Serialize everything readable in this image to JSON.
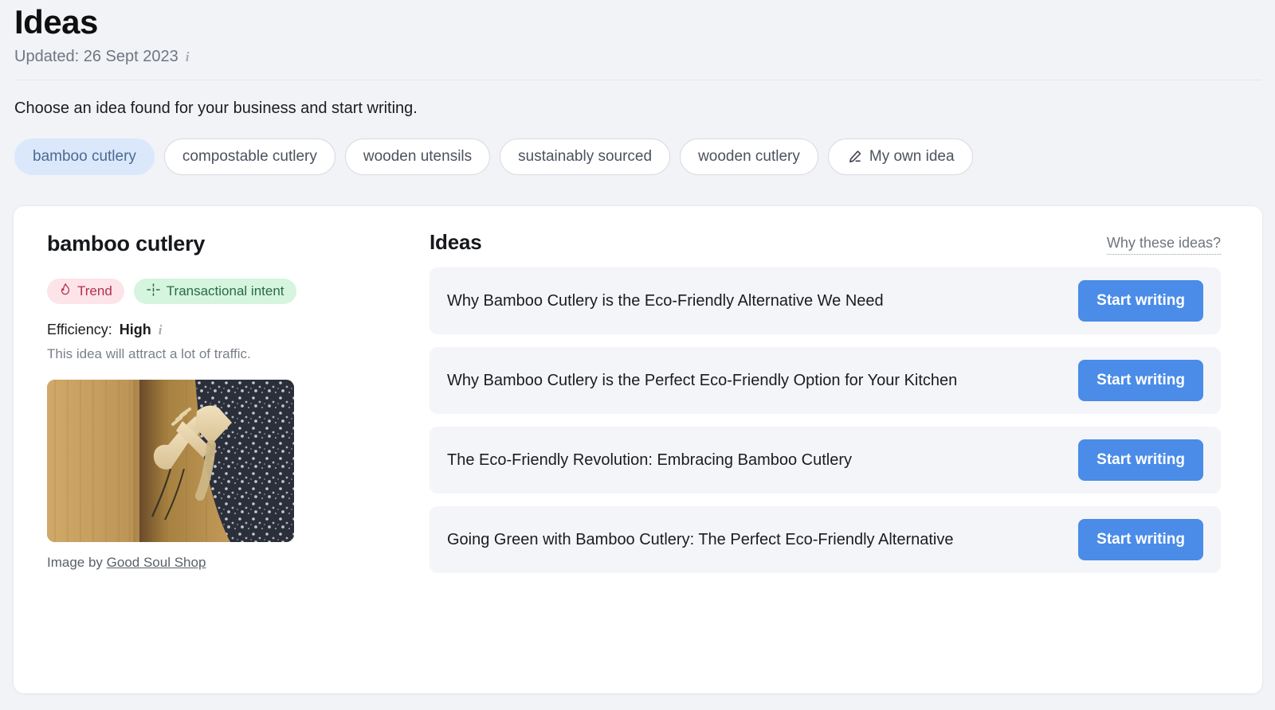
{
  "header": {
    "title": "Ideas",
    "updated_label": "Updated: 26 Sept 2023",
    "info_icon": "info-icon",
    "subtitle": "Choose an idea found for your business and start writing."
  },
  "chips": [
    {
      "label": "bamboo cutlery",
      "active": true,
      "icon": null
    },
    {
      "label": "compostable cutlery",
      "active": false,
      "icon": null
    },
    {
      "label": "wooden utensils",
      "active": false,
      "icon": null
    },
    {
      "label": "sustainably sourced",
      "active": false,
      "icon": null
    },
    {
      "label": "wooden cutlery",
      "active": false,
      "icon": null
    },
    {
      "label": "My own idea",
      "active": false,
      "icon": "pencil-icon"
    }
  ],
  "detail": {
    "keyword": "bamboo cutlery",
    "badges": [
      {
        "label": "Trend",
        "icon": "flame-icon",
        "bg": "#fce4e9",
        "fg": "#b2304b"
      },
      {
        "label": "Transactional intent",
        "icon": "intent-icon",
        "bg": "#d5f5de",
        "fg": "#2a6b44"
      }
    ],
    "efficiency_label": "Efficiency:",
    "efficiency_value": "High",
    "efficiency_info_icon": "info-icon",
    "efficiency_note": "This idea will attract a lot of traffic.",
    "image_alt": "bamboo cutlery set on a wooden board with a dark floral cloth",
    "credit_prefix": "Image by ",
    "credit_link": "Good Soul Shop"
  },
  "ideas_panel": {
    "title": "Ideas",
    "why_link": "Why these ideas?",
    "button_label": "Start writing",
    "items": [
      {
        "title": "Why Bamboo Cutlery is the Eco-Friendly Alternative We Need"
      },
      {
        "title": "Why Bamboo Cutlery is the Perfect Eco-Friendly Option for Your Kitchen"
      },
      {
        "title": "The Eco-Friendly Revolution: Embracing Bamboo Cutlery"
      },
      {
        "title": "Going Green with Bamboo Cutlery: The Perfect Eco-Friendly Alternative"
      }
    ]
  },
  "colors": {
    "page_bg": "#f2f3f7",
    "card_bg": "#ffffff",
    "row_bg": "#f3f5f8",
    "accent_button": "#4a8ce8",
    "chip_active_bg": "#dbe8fb",
    "chip_active_fg": "#4b6a93"
  }
}
